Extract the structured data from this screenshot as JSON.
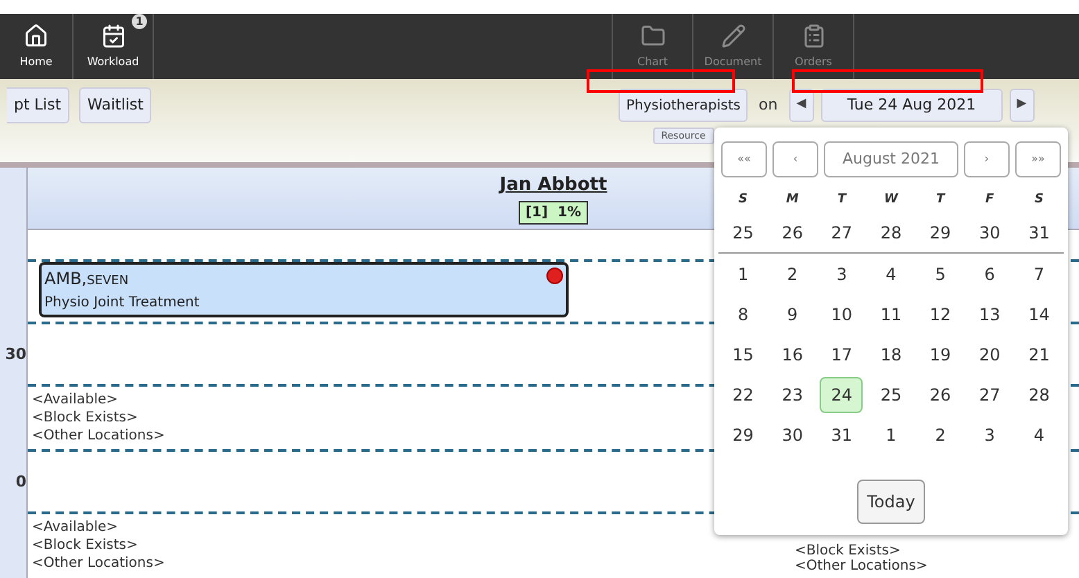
{
  "toolbar": {
    "items": [
      {
        "label": "Home",
        "kind": "home",
        "disabled": false
      },
      {
        "label": "Workload",
        "kind": "workload",
        "disabled": false,
        "badge": "1"
      },
      {
        "label": "Chart",
        "kind": "chart",
        "disabled": true
      },
      {
        "label": "Document",
        "kind": "document",
        "disabled": true
      },
      {
        "label": "Orders",
        "kind": "orders",
        "disabled": true
      }
    ]
  },
  "subtoolbar": {
    "buttons": [
      "pt List",
      "Waitlist"
    ],
    "resource_group": "Physiotherapists",
    "on_label": "on",
    "date": "Tue 24 Aug 2021",
    "prev": "◀",
    "next": "▶",
    "resource_button": "Resource"
  },
  "schedule": {
    "resource": {
      "name": "Jan Abbott",
      "badge": "[1]  1%"
    },
    "slots": [
      {
        "appointment": {
          "patient": "AMB,",
          "patient_suffix": "SEVEN",
          "type": "Physio Joint Treatment",
          "alert": true
        }
      },
      {
        "time": "30"
      },
      {
        "texts": [
          "<Available>",
          "<Block Exists>",
          "<Other Locations>"
        ]
      },
      {
        "time": "0"
      },
      {
        "texts": [
          "<Available>",
          "<Block Exists>",
          "<Other Locations>"
        ],
        "right_texts": [
          "<Block Exists>",
          "<Other Locations>"
        ]
      }
    ]
  },
  "calendar": {
    "nav": [
      "««",
      "‹",
      "August 2021",
      "›",
      "»»"
    ],
    "weekdays": [
      "S",
      "M",
      "T",
      "W",
      "T",
      "F",
      "S"
    ],
    "weeks": [
      [
        {
          "day": "25",
          "selected": false
        },
        {
          "day": "26",
          "selected": false
        },
        {
          "day": "27",
          "selected": false
        },
        {
          "day": "28",
          "selected": false
        },
        {
          "day": "29",
          "selected": false
        },
        {
          "day": "30",
          "selected": false
        },
        {
          "day": "31",
          "selected": false
        }
      ],
      [
        {
          "day": "1",
          "selected": false
        },
        {
          "day": "2",
          "selected": false
        },
        {
          "day": "3",
          "selected": false
        },
        {
          "day": "4",
          "selected": false
        },
        {
          "day": "5",
          "selected": false
        },
        {
          "day": "6",
          "selected": false
        },
        {
          "day": "7",
          "selected": false
        }
      ],
      [
        {
          "day": "8",
          "selected": false
        },
        {
          "day": "9",
          "selected": false
        },
        {
          "day": "10",
          "selected": false
        },
        {
          "day": "11",
          "selected": false
        },
        {
          "day": "12",
          "selected": false
        },
        {
          "day": "13",
          "selected": false
        },
        {
          "day": "14",
          "selected": false
        }
      ],
      [
        {
          "day": "15",
          "selected": false
        },
        {
          "day": "16",
          "selected": false
        },
        {
          "day": "17",
          "selected": false
        },
        {
          "day": "18",
          "selected": false
        },
        {
          "day": "19",
          "selected": false
        },
        {
          "day": "20",
          "selected": false
        },
        {
          "day": "21",
          "selected": false
        }
      ],
      [
        {
          "day": "22",
          "selected": false
        },
        {
          "day": "23",
          "selected": false
        },
        {
          "day": "24",
          "selected": true
        },
        {
          "day": "25",
          "selected": false
        },
        {
          "day": "26",
          "selected": false
        },
        {
          "day": "27",
          "selected": false
        },
        {
          "day": "28",
          "selected": false
        }
      ],
      [
        {
          "day": "29",
          "selected": false
        },
        {
          "day": "30",
          "selected": false
        },
        {
          "day": "31",
          "selected": false
        },
        {
          "day": "1",
          "selected": false
        },
        {
          "day": "2",
          "selected": false
        },
        {
          "day": "3",
          "selected": false
        },
        {
          "day": "4",
          "selected": false
        }
      ]
    ],
    "today": "Today"
  }
}
